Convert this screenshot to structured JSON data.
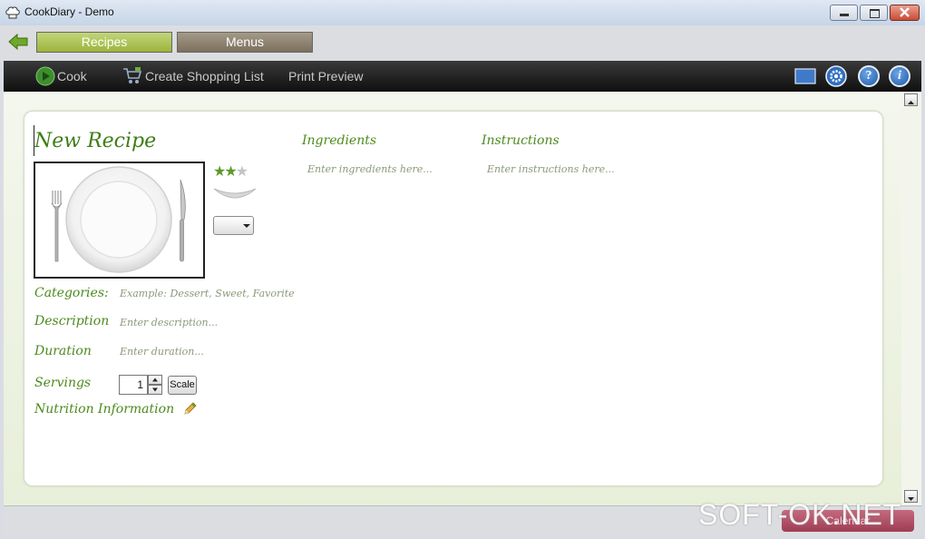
{
  "window": {
    "title": "CookDiary - Demo"
  },
  "nav": {
    "tabs": [
      {
        "label": "Recipes"
      },
      {
        "label": "Menus"
      }
    ]
  },
  "toolbar": {
    "cook_label": "Cook",
    "shopping_label": "Create Shopping List",
    "print_label": "Print Preview",
    "help_glyph": "?",
    "info_glyph": "i"
  },
  "recipe": {
    "title": "New Recipe",
    "rating": 2,
    "rating_max": 3,
    "ingredients": {
      "label": "Ingredients",
      "placeholder": "Enter ingredients here..."
    },
    "instructions": {
      "label": "Instructions",
      "placeholder": "Enter instructions here..."
    },
    "categories": {
      "label": "Categories:",
      "placeholder": "Example: Dessert, Sweet, Favorite"
    },
    "description": {
      "label": "Description",
      "placeholder": "Enter description..."
    },
    "duration": {
      "label": "Duration",
      "placeholder": "Enter duration..."
    },
    "servings": {
      "label": "Servings",
      "value": "1",
      "scale_label": "Scale"
    },
    "nutrition": {
      "label": "Nutrition Information"
    }
  },
  "status": {
    "button_label": "Calendar"
  },
  "watermark": {
    "text": "SOFT-OK.NET"
  },
  "colors": {
    "accent_green": "#4c8a1e",
    "recipes_tab": "#9db43c",
    "menus_tab": "#7c6f5e",
    "toolbar_bg": "#1a1a1a"
  },
  "icons": [
    "chef-hat-icon",
    "back-arrow-icon",
    "play-icon",
    "cart-icon",
    "window-icon",
    "gear-icon",
    "help-icon",
    "info-icon",
    "pencil-icon",
    "fork-icon",
    "knife-icon",
    "plate-icon"
  ]
}
